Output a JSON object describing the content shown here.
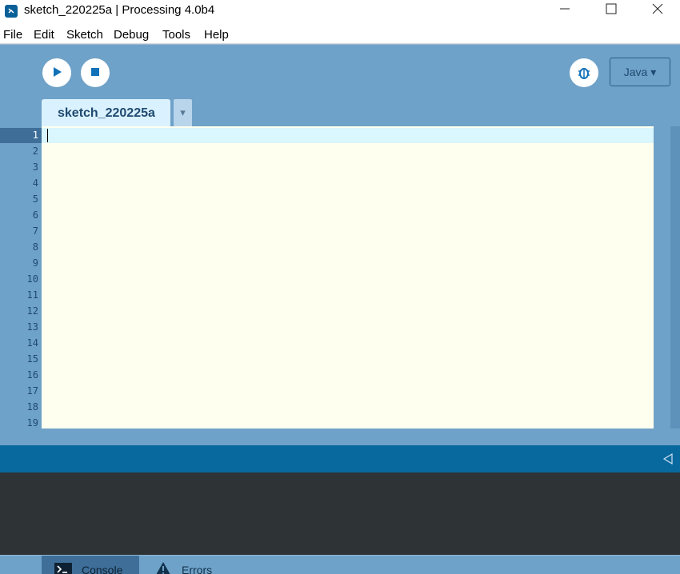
{
  "window": {
    "title": "sketch_220225a | Processing 4.0b4",
    "controls": [
      "minimize-icon",
      "maximize-icon",
      "close-icon"
    ]
  },
  "menu": {
    "items": [
      "File",
      "Edit",
      "Sketch",
      "Debug",
      "Tools",
      "Help"
    ]
  },
  "toolbar": {
    "run_icon": "play-icon",
    "stop_icon": "stop-icon",
    "debug_icon": "bug-icon",
    "mode": "Java ▾"
  },
  "editor": {
    "tab": "sketch_220225a",
    "tab_menu": "▾",
    "current_line": 1,
    "lines": [
      "1",
      "2",
      "3",
      "4",
      "5",
      "6",
      "7",
      "8",
      "9",
      "10",
      "11",
      "12",
      "13",
      "14",
      "15",
      "16",
      "17",
      "18",
      "19"
    ]
  },
  "console": {
    "collapse_icon": "collapse-left-icon",
    "tabs": [
      "Console",
      "Errors"
    ]
  },
  "colors": {
    "toolbar_blue": "#6fa2c8",
    "editor_background": "#fffff0",
    "current_line": "#daf6fe",
    "status_bar": "#08699f",
    "console_background": "#2e3336"
  }
}
